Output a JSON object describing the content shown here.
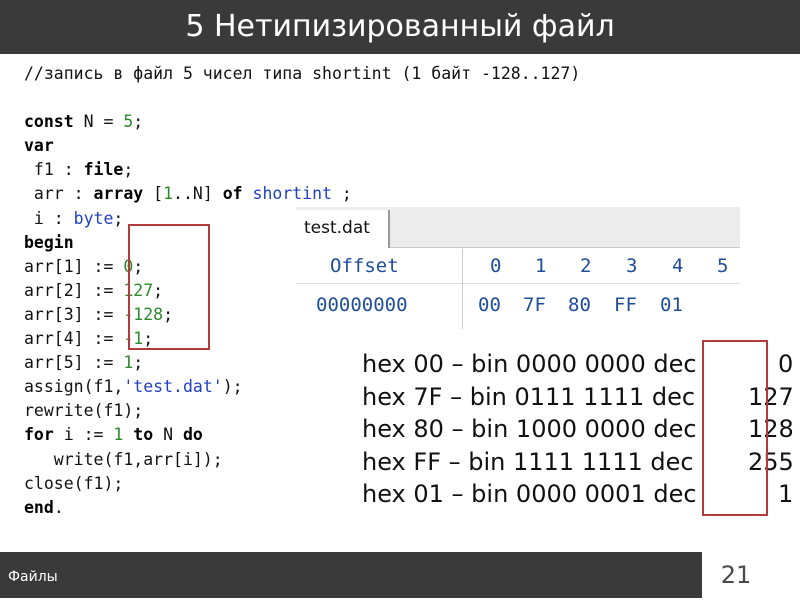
{
  "slide": {
    "title": "5 Нетипизированный файл",
    "footer": "Файлы",
    "page_number": "21"
  },
  "colors": {
    "title_bar": "#3a3a3a",
    "keyword": "#000000",
    "number": "#2a8a2a",
    "string": "#2040c0",
    "hex_text": "#1e4d9a",
    "highlight_box": "#b33a3a"
  },
  "code": {
    "comment": "//запись в файл 5 чисел типа shortint (1 байт -128..127)",
    "const_kw": "const",
    "const_body": " N = ",
    "const_val": "5",
    "semicolon": ";",
    "var_kw": "var",
    "f1_decl_a": " f1 : ",
    "f1_decl_kw": "file",
    "arr_decl_a": " arr : ",
    "arr_decl_kw": "array",
    "arr_decl_b": " [",
    "arr_decl_one": "1",
    "arr_decl_c": "..N] ",
    "arr_decl_of": "of",
    "arr_decl_sp": " ",
    "arr_decl_type": "shortint",
    "arr_decl_end": " ;",
    "i_decl_a": " i : ",
    "i_decl_type": "byte",
    "begin_kw": "begin",
    "assigns": [
      {
        "lhs": "arr[1] := ",
        "value": "0"
      },
      {
        "lhs": "arr[2] := ",
        "value": "127"
      },
      {
        "lhs": "arr[3] := ",
        "value": "-128"
      },
      {
        "lhs": "arr[4] := ",
        "value": "-1"
      },
      {
        "lhs": "arr[5] := ",
        "value": "1"
      }
    ],
    "assign_a": "assign(f1,",
    "assign_str": "'test.dat'",
    "assign_b": ");",
    "rewrite": "rewrite(f1);",
    "for_kw": "for",
    "for_a": " i := ",
    "for_one": "1",
    "for_sp": " ",
    "to_kw": "to",
    "for_b": " N ",
    "do_kw": "do",
    "write_line": "   write(f1,arr[i]);",
    "close_line": "close(f1);",
    "end_kw": "end",
    "end_dot": "."
  },
  "hex_viewer": {
    "tab": "test.dat",
    "offset_header": "Offset",
    "columns": [
      "0",
      "1",
      "2",
      "3",
      "4",
      "5"
    ],
    "row_offset": "00000000",
    "row_bytes": [
      "00",
      "7F",
      "80",
      "FF",
      "01"
    ]
  },
  "conversions": [
    {
      "text": "hex 00 – bin 0000 0000 dec",
      "dec": "0"
    },
    {
      "text": "hex 7F – bin 0111 1111 dec",
      "dec": "127"
    },
    {
      "text": "hex 80 – bin 1000 0000 dec",
      "dec": "128"
    },
    {
      "text": "hex FF – bin 1111 1111 dec",
      "dec": "255"
    },
    {
      "text": "hex 01 – bin 0000 0001 dec",
      "dec": "1"
    }
  ]
}
